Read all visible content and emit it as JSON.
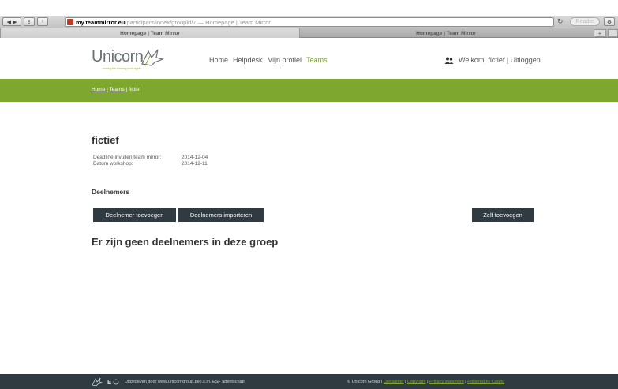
{
  "browser": {
    "url_host": "my.teammirror.eu",
    "url_path": "/participant/index/groupid/7 — Homepage | Team Mirror",
    "reader": "Reader",
    "tabs": [
      {
        "label": "Homepage | Team Mirror",
        "active": true
      },
      {
        "label": "Homepage | Team Mirror",
        "active": false
      }
    ]
  },
  "header": {
    "logo_text": "Unicorn",
    "logo_sub": "making the learning work again",
    "nav": [
      {
        "label": "Home",
        "active": false
      },
      {
        "label": "Helpdesk",
        "active": false
      },
      {
        "label": "Mijn profiel",
        "active": false
      },
      {
        "label": "Teams",
        "active": true
      }
    ],
    "welcome": "Welkom, fictief | Uitloggen"
  },
  "breadcrumb": {
    "home": "Home",
    "sep1": " | ",
    "teams": "Teams",
    "sep2": " | ",
    "current": "fictief"
  },
  "group": {
    "title": "fictief",
    "deadline_label": "Deadline invullen team mirror:",
    "deadline_value": "2014-12-04",
    "workshop_label": "Datum workshop:",
    "workshop_value": "2014-12-11"
  },
  "participants": {
    "heading": "Deelnemers",
    "add_label": "Deelnemer toevoegen",
    "import_label": "Deelnemers importeren",
    "self_label": "Zelf toevoegen",
    "empty_text": "Er zijn geen deelnemers in deze groep"
  },
  "footer": {
    "left_text": "Uitgegeven door www.unicorngroup.be i.s.m. ESF agentschap",
    "right_prefix": "© Unicorn Group | ",
    "disclaimer": "Disclaimer",
    "copyright": "Copyright",
    "privacy": "Privacy statement",
    "powered": "Powered by Cod80",
    "sep": " | "
  },
  "colors": {
    "accent_green": "#7ea72f",
    "dark_slate": "#2f3a41"
  }
}
